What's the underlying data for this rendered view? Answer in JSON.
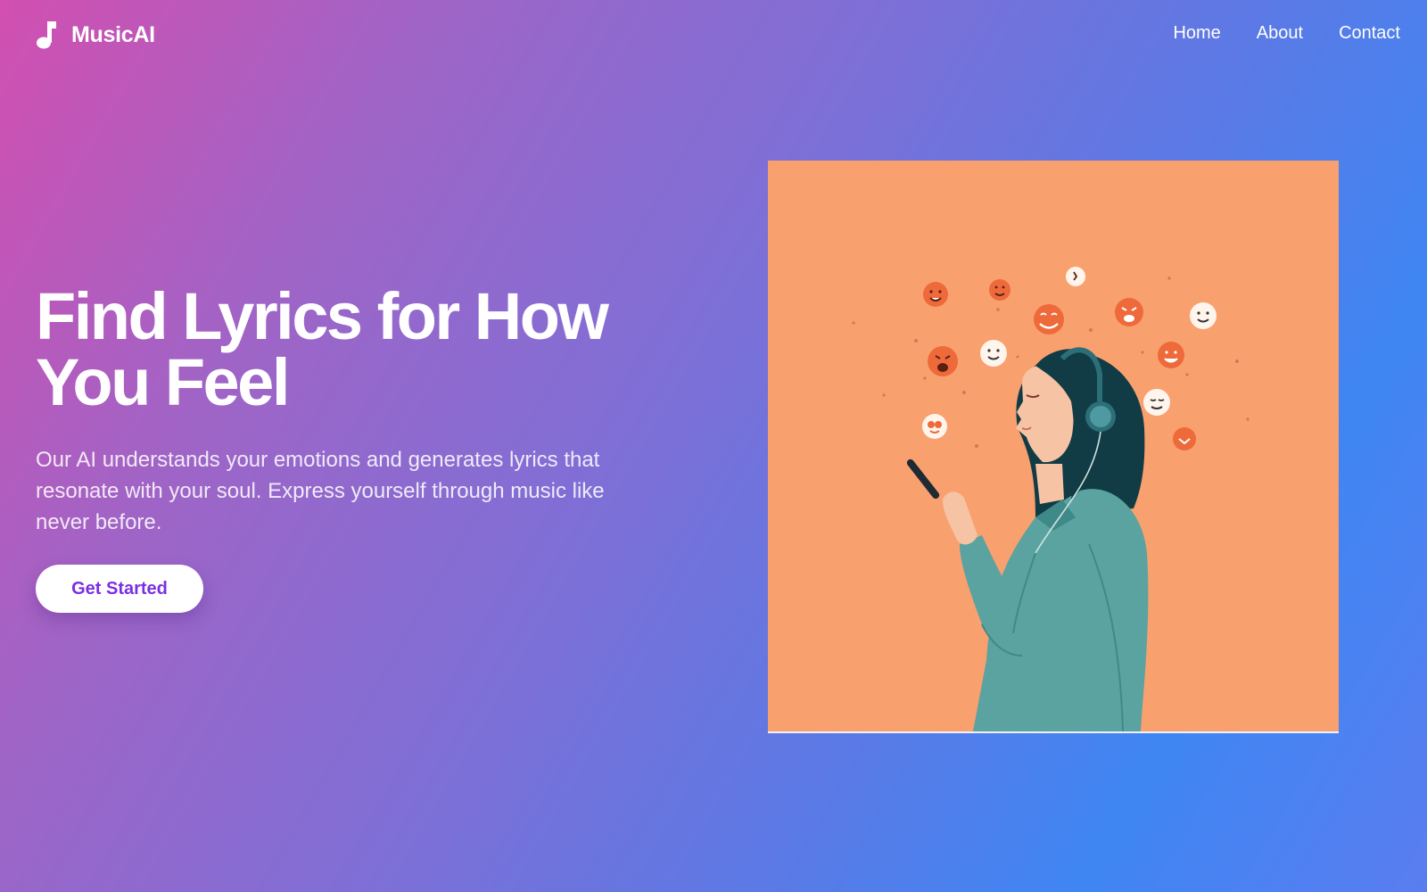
{
  "nav": {
    "brand": "MusicAI",
    "brand_icon": "music-note-icon",
    "links": [
      "Home",
      "About",
      "Contact"
    ]
  },
  "hero": {
    "headline_line1": "Find Lyrics for How",
    "headline_line2": "You Feel",
    "subtitle": "Our AI understands your emotions and generates lyrics that resonate with your soul. Express yourself through music like never before.",
    "cta_label": "Get Started"
  },
  "illustration": {
    "subject": "woman-with-headphones-and-phone",
    "icons": [
      "emoji-faces",
      "headphones-icon",
      "phone-icon"
    ]
  },
  "colors": {
    "gradient_start": "#d24fb0",
    "gradient_end": "#3f86f3",
    "cta_text": "#7b2fe3",
    "illustration_bg": "#f9a06f",
    "emoji_orange": "#ee6a3a",
    "jacket": "#5aa3a0",
    "hair": "#123c45"
  }
}
